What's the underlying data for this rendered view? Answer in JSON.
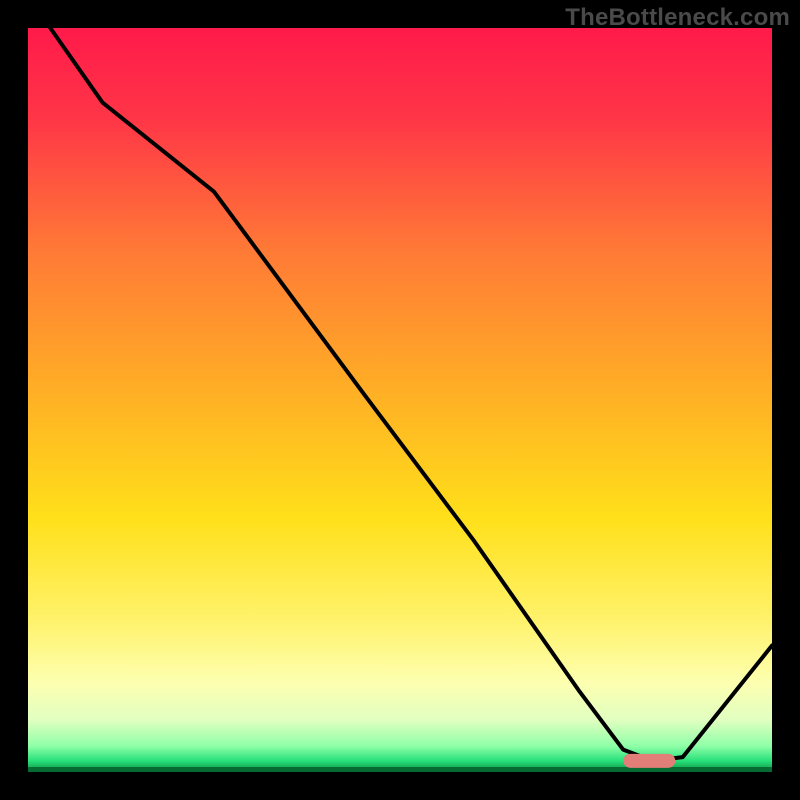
{
  "watermark": "TheBottleneck.com",
  "chart_data": {
    "type": "line",
    "title": "",
    "xlabel": "",
    "ylabel": "",
    "xlim": [
      0,
      100
    ],
    "ylim": [
      0,
      100
    ],
    "x": [
      3,
      10,
      25,
      45,
      60,
      74,
      80,
      84,
      88,
      100
    ],
    "values": [
      100,
      90,
      78,
      51,
      31,
      11,
      3,
      1.5,
      2,
      17
    ],
    "marker": {
      "x_start": 80,
      "x_end": 87,
      "y": 1.5
    },
    "gradient_stops": [
      {
        "offset": 0.0,
        "color": "#ff1a4a"
      },
      {
        "offset": 0.12,
        "color": "#ff3547"
      },
      {
        "offset": 0.3,
        "color": "#ff7a36"
      },
      {
        "offset": 0.5,
        "color": "#ffb224"
      },
      {
        "offset": 0.66,
        "color": "#ffe01a"
      },
      {
        "offset": 0.8,
        "color": "#fff36e"
      },
      {
        "offset": 0.88,
        "color": "#fdffb0"
      },
      {
        "offset": 0.93,
        "color": "#e1ffc0"
      },
      {
        "offset": 0.965,
        "color": "#8fffa8"
      },
      {
        "offset": 0.985,
        "color": "#28e07a"
      },
      {
        "offset": 1.0,
        "color": "#0a8d3f"
      }
    ],
    "colors": {
      "line": "#000000",
      "marker": "#e17e78",
      "background": "#000000"
    }
  }
}
